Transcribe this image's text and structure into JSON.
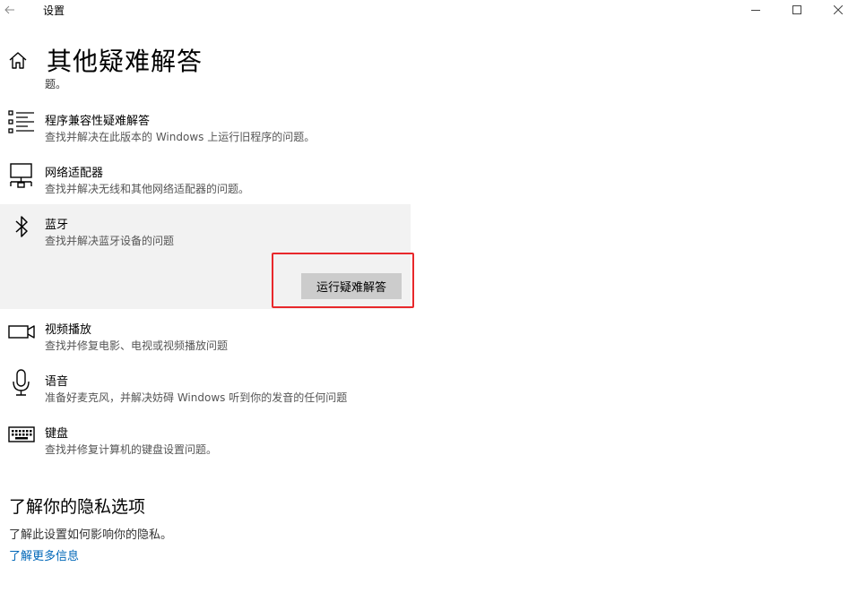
{
  "window": {
    "title": "设置",
    "back_icon": "back-arrow-icon",
    "controls": [
      "minimize-icon",
      "maximize-icon",
      "close-icon"
    ]
  },
  "header": {
    "home_icon": "home-icon",
    "title": "其他疑难解答",
    "cut_off_text": "题。"
  },
  "troubleshooters": [
    {
      "icon": "list-icon",
      "title": "程序兼容性疑难解答",
      "description": "查找并解决在此版本的 Windows 上运行旧程序的问题。"
    },
    {
      "icon": "network-adapter-icon",
      "title": "网络适配器",
      "description": "查找并解决无线和其他网络适配器的问题。"
    },
    {
      "icon": "bluetooth-icon",
      "title": "蓝牙",
      "description": "查找并解决蓝牙设备的问题",
      "selected": true
    },
    {
      "icon": "video-camera-icon",
      "title": "视频播放",
      "description": "查找并修复电影、电视或视频播放问题"
    },
    {
      "icon": "microphone-icon",
      "title": "语音",
      "description": "准备好麦克风，并解决妨碍 Windows 听到你的发音的任何问题"
    },
    {
      "icon": "keyboard-icon",
      "title": "键盘",
      "description": "查找并修复计算机的键盘设置问题。"
    }
  ],
  "run_button": {
    "label": "运行疑难解答"
  },
  "highlight_color": "#e8282b",
  "privacy": {
    "heading": "了解你的隐私选项",
    "description": "了解此设置如何影响你的隐私。",
    "link": "了解更多信息",
    "link_color": "#0067b8"
  }
}
